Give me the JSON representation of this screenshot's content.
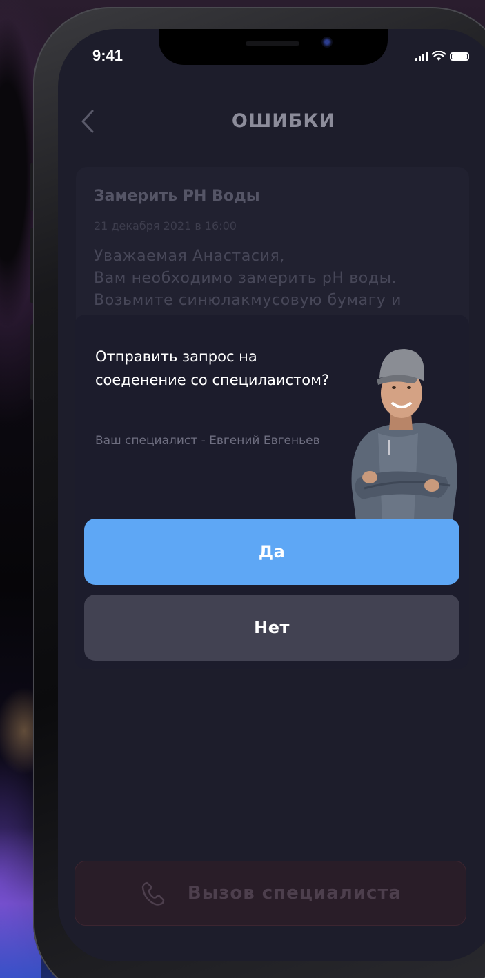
{
  "status_bar": {
    "time": "9:41"
  },
  "header": {
    "back_icon": "chevron-left-icon",
    "title": "ОШИБКИ"
  },
  "message": {
    "title": "Замерить РН Воды",
    "date": "21 декабря 2021 в 16:00",
    "body": "Уважаемая Анастасия,\nВам необходимо замерить pH воды.\nВозьмите синюлакмусовую бумагу и"
  },
  "dialog": {
    "question": "Отправить запрос на соеденение со специлаистом?",
    "specialist": "Ваш специалист - Евгений Евгеньев",
    "yes_label": "Да",
    "no_label": "Нет"
  },
  "call_button": {
    "label": "Вызов специалиста",
    "icon": "phone-icon"
  },
  "colors": {
    "accent": "#5ea7f5",
    "screen_bg": "#1d1d2b",
    "secondary_button": "#424252",
    "call_button_bg": "#291d28"
  }
}
